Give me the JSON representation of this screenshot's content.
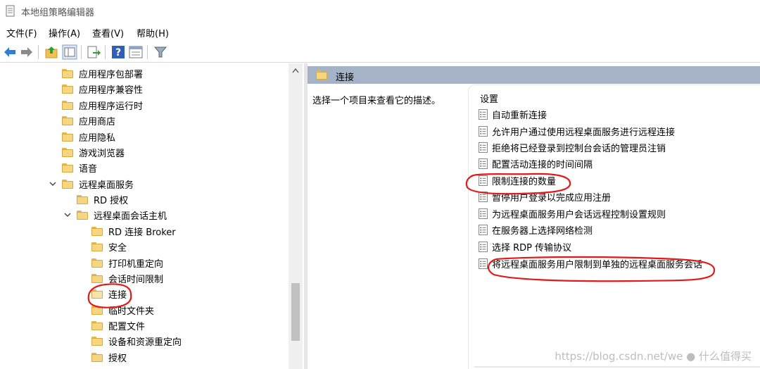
{
  "window": {
    "title": "本地组策略编辑器"
  },
  "menu": [
    "文件(F)",
    "操作(A)",
    "查看(V)",
    "帮助(H)"
  ],
  "toolbar": {
    "buttons": [
      "back-arrow-icon",
      "forward-arrow-icon",
      "up-folder-icon",
      "show-hide-tree-icon",
      "export-list-icon",
      "help-icon",
      "properties-icon",
      "filter-icon"
    ]
  },
  "tree": {
    "items": [
      {
        "label": "应用程序包部署"
      },
      {
        "label": "应用程序兼容性"
      },
      {
        "label": "应用程序运行时"
      },
      {
        "label": "应用商店"
      },
      {
        "label": "应用隐私"
      },
      {
        "label": "游戏浏览器"
      },
      {
        "label": "语音"
      },
      {
        "label": "远程桌面服务"
      },
      {
        "label": "RD 授权"
      },
      {
        "label": "远程桌面会话主机"
      },
      {
        "label": "RD 连接 Broker"
      },
      {
        "label": "安全"
      },
      {
        "label": "打印机重定向"
      },
      {
        "label": "会话时间限制"
      },
      {
        "label": "连接"
      },
      {
        "label": "临时文件夹"
      },
      {
        "label": "配置文件"
      },
      {
        "label": "设备和资源重定向"
      },
      {
        "label": "授权"
      }
    ]
  },
  "right": {
    "header": "连接",
    "description": "选择一个项目来查看它的描述。",
    "settings_header": "设置",
    "settings": [
      "自动重新连接",
      "允许用户通过使用远程桌面服务进行远程连接",
      "拒绝将已经登录到控制台会话的管理员注销",
      "配置活动连接的时间间隔",
      "限制连接的数量",
      "暂停用户登录以完成应用注册",
      "为远程桌面服务用户会话远程控制设置规则",
      "在服务器上选择网络检测",
      "选择 RDP 传输协议",
      "将远程桌面服务用户限制到单独的远程桌面服务会话"
    ]
  },
  "watermark": {
    "url": "https://blog.csdn.net/we",
    "brand": "什么值得买"
  },
  "colors": {
    "header_bar": "#a5b3c9",
    "annotation": "#e01919",
    "folder": "#f6d680"
  }
}
